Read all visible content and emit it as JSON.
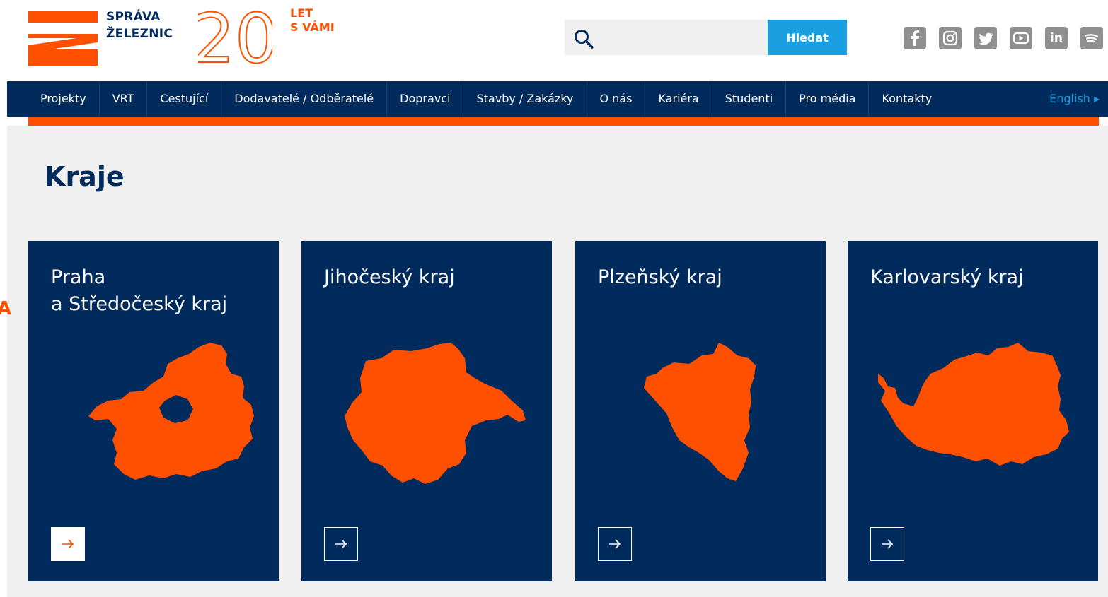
{
  "brand": {
    "name_line1": "SPRÁVA",
    "name_line2": "ŽELEZNIC",
    "anniversary_number": "20",
    "anniversary_line1": "LET",
    "anniversary_line2": "S VÁMI"
  },
  "search": {
    "placeholder": "",
    "value": "",
    "button_label": "Hledat"
  },
  "social": [
    {
      "icon": "facebook-icon"
    },
    {
      "icon": "instagram-icon"
    },
    {
      "icon": "twitter-icon"
    },
    {
      "icon": "youtube-icon"
    },
    {
      "icon": "linkedin-icon",
      "label": "in"
    },
    {
      "icon": "spotify-icon"
    }
  ],
  "nav": {
    "items": [
      "Projekty",
      "VRT",
      "Cestující",
      "Dodavatelé / Odběratelé",
      "Dopravci",
      "Stavby / Zakázky",
      "O nás",
      "Kariéra",
      "Studenti",
      "Pro média",
      "Kontakty"
    ],
    "language": "English ▸"
  },
  "page": {
    "title": "Kraje",
    "side_mark": "A"
  },
  "cards": [
    {
      "title": "Praha\na Středočeský kraj",
      "map_icon": "region-map-icon"
    },
    {
      "title": "Jihočeský kraj",
      "map_icon": "region-map-icon"
    },
    {
      "title": "Plzeňský kraj",
      "map_icon": "region-map-icon"
    },
    {
      "title": "Karlovarský kraj",
      "map_icon": "region-map-icon"
    }
  ],
  "colors": {
    "brand_blue": "#002b5c",
    "brand_orange": "#ff5000",
    "accent_blue": "#1a9fe0",
    "background_gray": "#f0f0f0"
  }
}
